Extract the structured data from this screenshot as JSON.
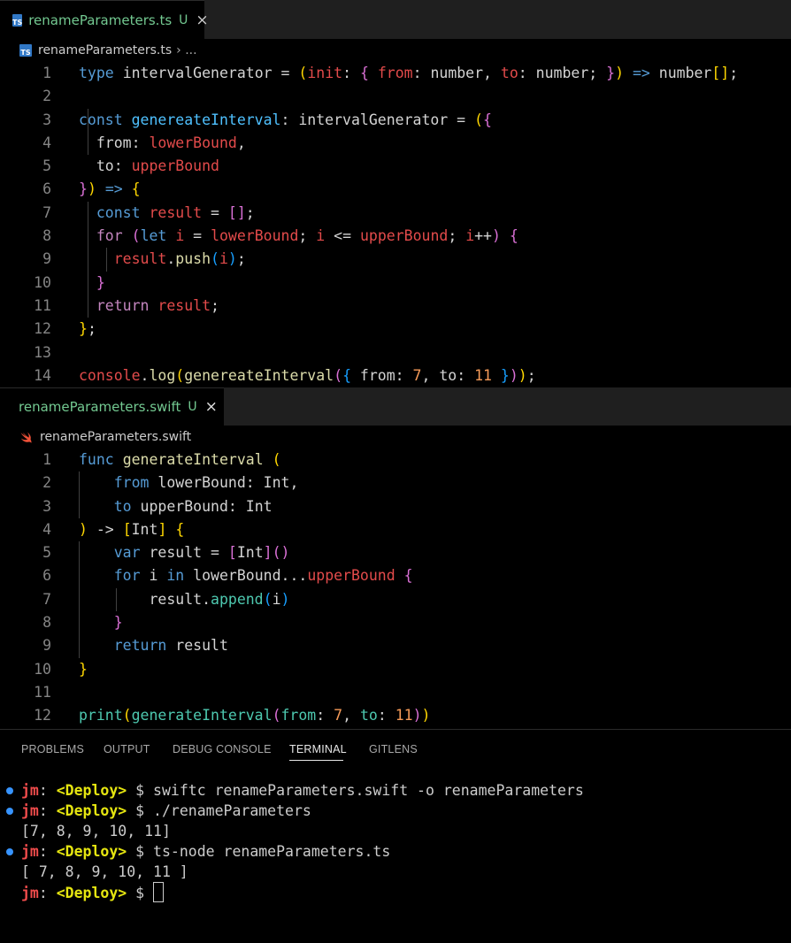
{
  "ts_tab": {
    "name": "renameParameters.ts",
    "status": "U",
    "close": "×",
    "icon": "typescript-icon"
  },
  "ts_breadcrumb": {
    "file": "renameParameters.ts",
    "sep": "› ..."
  },
  "ts_code": {
    "lines": [
      "1",
      "2",
      "3",
      "4",
      "5",
      "6",
      "7",
      "8",
      "9",
      "10",
      "11",
      "12",
      "13",
      "14"
    ]
  },
  "swift_tab": {
    "name": "renameParameters.swift",
    "status": "U",
    "close": "×",
    "icon": "swift-icon"
  },
  "swift_breadcrumb": {
    "file": "renameParameters.swift"
  },
  "swift_code": {
    "lines": [
      "1",
      "2",
      "3",
      "4",
      "5",
      "6",
      "7",
      "8",
      "9",
      "10",
      "11",
      "12"
    ]
  },
  "panel": {
    "tabs": [
      "PROBLEMS",
      "OUTPUT",
      "DEBUG CONSOLE",
      "TERMINAL",
      "GITLENS"
    ],
    "active_tab": "TERMINAL"
  },
  "terminal": {
    "user": "jm",
    "branch": "<Deploy>",
    "prompt": "$",
    "cmd1": "swiftc renameParameters.swift -o renameParameters",
    "cmd2": "./renameParameters",
    "out2": "[7, 8, 9, 10, 11]",
    "cmd3": "ts-node renameParameters.ts",
    "out3": "[ 7, 8, 9, 10, 11 ]"
  },
  "colors": {
    "background": "#000000",
    "ts_logo": "#3178c6",
    "swift_logo": "#f05138",
    "modified": "#73c991",
    "prompt_dot": "#3794ff"
  }
}
